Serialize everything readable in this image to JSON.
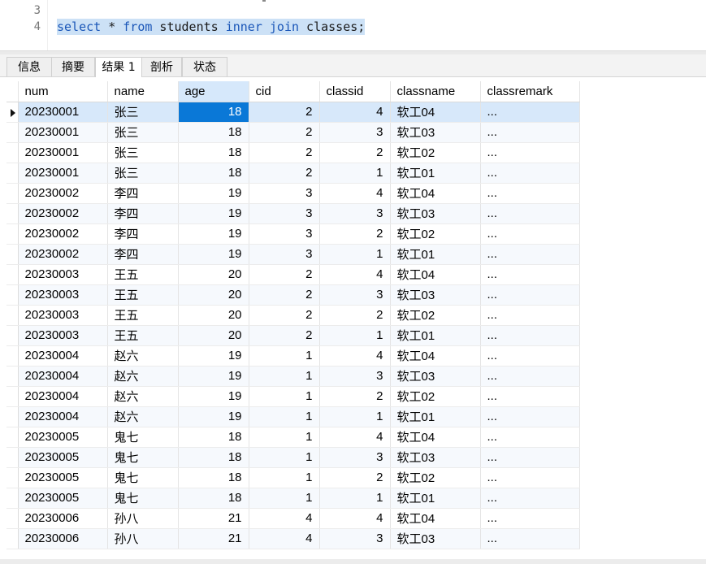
{
  "editor": {
    "line_numbers": [
      "3",
      "4"
    ],
    "sql_tokens": [
      {
        "text": "select",
        "kind": "kw"
      },
      {
        "text": " * ",
        "kind": "plain"
      },
      {
        "text": "from",
        "kind": "kw"
      },
      {
        "text": " students ",
        "kind": "plain"
      },
      {
        "text": "inner",
        "kind": "kw"
      },
      {
        "text": " ",
        "kind": "plain"
      },
      {
        "text": "join",
        "kind": "kw"
      },
      {
        "text": " classes;",
        "kind": "plain"
      }
    ]
  },
  "tabs": [
    "信息",
    "摘要",
    "结果 1",
    "剖析",
    "状态"
  ],
  "active_tab": 2,
  "grid": {
    "columns": [
      "num",
      "name",
      "age",
      "cid",
      "classid",
      "classname",
      "classremark"
    ],
    "sorted_column": 2,
    "rows": [
      [
        "20230001",
        "张三",
        "18",
        "2",
        "4",
        "软工04",
        "..."
      ],
      [
        "20230001",
        "张三",
        "18",
        "2",
        "3",
        "软工03",
        "..."
      ],
      [
        "20230001",
        "张三",
        "18",
        "2",
        "2",
        "软工02",
        "..."
      ],
      [
        "20230001",
        "张三",
        "18",
        "2",
        "1",
        "软工01",
        "..."
      ],
      [
        "20230002",
        "李四",
        "19",
        "3",
        "4",
        "软工04",
        "..."
      ],
      [
        "20230002",
        "李四",
        "19",
        "3",
        "3",
        "软工03",
        "..."
      ],
      [
        "20230002",
        "李四",
        "19",
        "3",
        "2",
        "软工02",
        "..."
      ],
      [
        "20230002",
        "李四",
        "19",
        "3",
        "1",
        "软工01",
        "..."
      ],
      [
        "20230003",
        "王五",
        "20",
        "2",
        "4",
        "软工04",
        "..."
      ],
      [
        "20230003",
        "王五",
        "20",
        "2",
        "3",
        "软工03",
        "..."
      ],
      [
        "20230003",
        "王五",
        "20",
        "2",
        "2",
        "软工02",
        "..."
      ],
      [
        "20230003",
        "王五",
        "20",
        "2",
        "1",
        "软工01",
        "..."
      ],
      [
        "20230004",
        "赵六",
        "19",
        "1",
        "4",
        "软工04",
        "..."
      ],
      [
        "20230004",
        "赵六",
        "19",
        "1",
        "3",
        "软工03",
        "..."
      ],
      [
        "20230004",
        "赵六",
        "19",
        "1",
        "2",
        "软工02",
        "..."
      ],
      [
        "20230004",
        "赵六",
        "19",
        "1",
        "1",
        "软工01",
        "..."
      ],
      [
        "20230005",
        "鬼七",
        "18",
        "1",
        "4",
        "软工04",
        "..."
      ],
      [
        "20230005",
        "鬼七",
        "18",
        "1",
        "3",
        "软工03",
        "..."
      ],
      [
        "20230005",
        "鬼七",
        "18",
        "1",
        "2",
        "软工02",
        "..."
      ],
      [
        "20230005",
        "鬼七",
        "18",
        "1",
        "1",
        "软工01",
        "..."
      ],
      [
        "20230006",
        "孙八",
        "21",
        "4",
        "4",
        "软工04",
        "..."
      ],
      [
        "20230006",
        "孙八",
        "21",
        "4",
        "3",
        "软工03",
        "..."
      ]
    ],
    "current_row": 0,
    "selected_cell_column": 2
  },
  "colors": {
    "selection": "#cce1f6",
    "keyword": "#1a56b8",
    "selected_cell": "#0a78d7",
    "current_row": "#d7e8fa"
  }
}
